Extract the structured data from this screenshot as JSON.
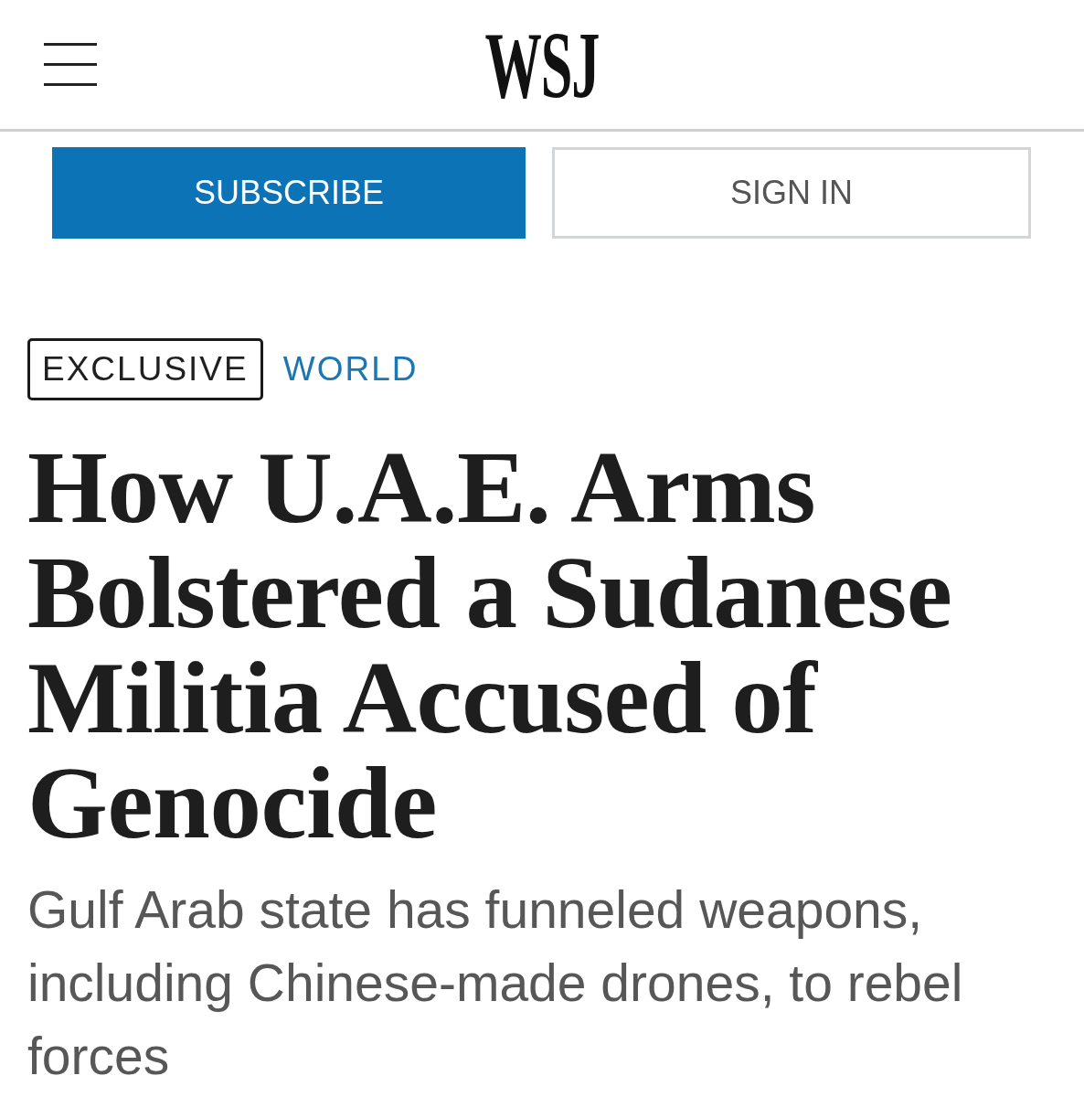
{
  "header": {
    "logo": "WSJ"
  },
  "actions": [
    {
      "label": "SUBSCRIBE",
      "kind": "primary"
    },
    {
      "label": "SIGN IN",
      "kind": "secondary"
    }
  ],
  "article": {
    "flags": [
      {
        "label": "EXCLUSIVE",
        "kind": "badge"
      },
      {
        "label": "WORLD",
        "kind": "section"
      }
    ],
    "headline": "How U.A.E. Arms Bolstered a Sudanese Militia Accused of Genocide",
    "dek": "Gulf Arab state has funneled weapons, including Chinese-made drones, to rebel forces"
  }
}
